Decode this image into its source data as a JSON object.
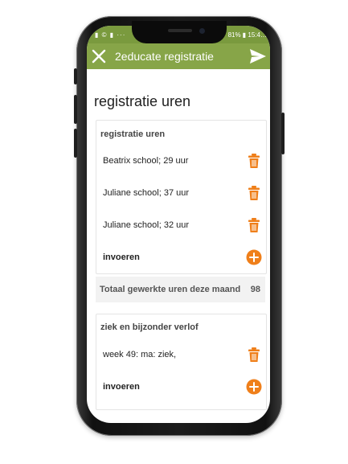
{
  "status_bar": {
    "left": "▮ © ▮ ···",
    "right": "81% ▮ 15:4…"
  },
  "app_bar": {
    "title": "2educate registratie",
    "close_icon": "close-icon",
    "send_icon": "send-icon"
  },
  "page": {
    "title": "registratie uren"
  },
  "section_hours": {
    "header": "registratie uren",
    "entries": [
      {
        "label": "Beatrix school; 29 uur"
      },
      {
        "label": "Juliane school; 37 uur"
      },
      {
        "label": "Juliane school; 32 uur"
      }
    ],
    "add_label": "invoeren"
  },
  "total": {
    "label": "Totaal gewerkte uren deze maand",
    "value": "98"
  },
  "section_leave": {
    "header": "ziek en bijzonder verlof",
    "entries": [
      {
        "label": "week 49: ma: ziek,"
      }
    ],
    "add_label": "invoeren"
  },
  "colors": {
    "app_bar": "#87a548",
    "status_bar": "#7a9a3e",
    "accent": "#ef7f1a"
  }
}
